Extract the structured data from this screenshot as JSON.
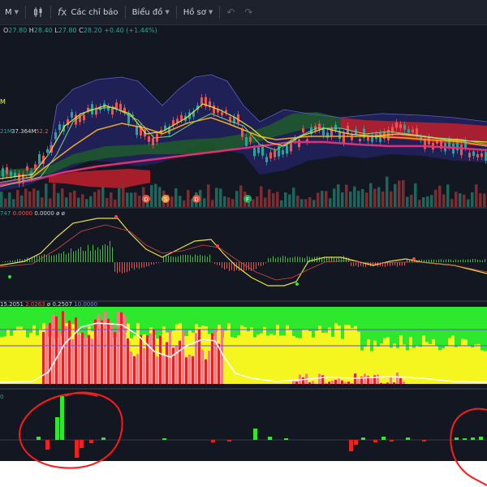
{
  "toolbar": {
    "interval_label": "M",
    "indicators_label": "Các chỉ báo",
    "chart_label": "Biểu đồ",
    "profile_label": "Hồ sơ"
  },
  "ohlc": {
    "o_key": "O",
    "o_val": "27.80",
    "h_key": "H",
    "h_val": "28.40",
    "l_key": "L",
    "l_val": "27.80",
    "c_key": "C",
    "c_val": "28.20",
    "change": "+0.40 (+1.44%)"
  },
  "price_labels": {
    "left_tag": "M",
    "volume_a": "21M",
    "volume_b": "37.364M",
    "volume_c": "52.2"
  },
  "event_markers": [
    "D",
    "S",
    "D",
    "F"
  ],
  "macd_values": {
    "v1": "747",
    "v2": "0.0000",
    "v3": "0.0000",
    "v4": "ø",
    "v5": "ø"
  },
  "osc_values": {
    "v1": "15.2051",
    "v2": "2.0263",
    "v3": "ø",
    "v4": "0.2507",
    "v5": "10.0000"
  },
  "bottom_label": "0",
  "colors": {
    "background": "#131722",
    "up": "#26a69a",
    "down": "#ef5350",
    "bright_green": "#2ee82e",
    "yellow": "#f5f51f",
    "annotation_red": "#ff1a1a"
  }
}
